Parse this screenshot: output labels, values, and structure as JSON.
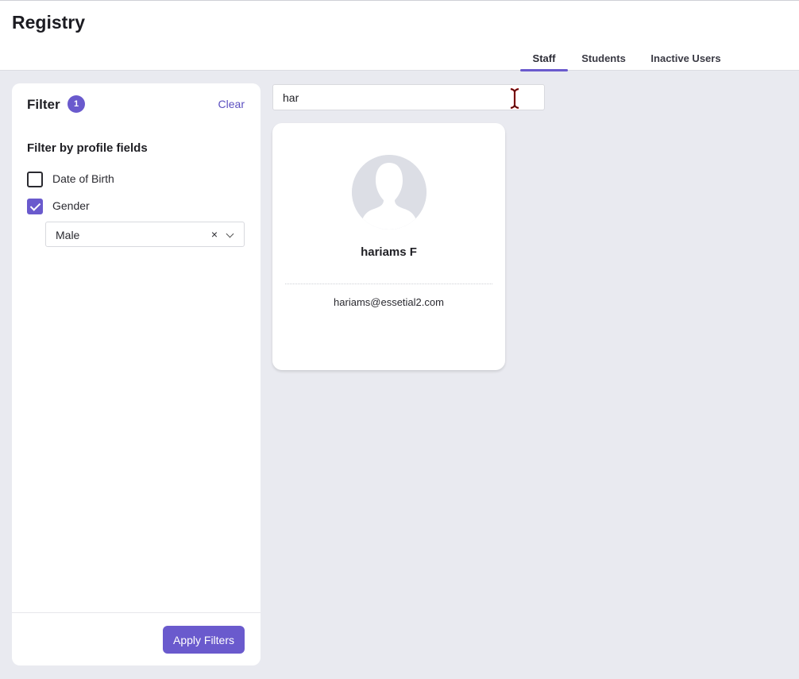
{
  "app": {
    "title": "Registry"
  },
  "tabs": [
    {
      "label": "Staff",
      "active": true
    },
    {
      "label": "Students",
      "active": false
    },
    {
      "label": "Inactive Users",
      "active": false
    }
  ],
  "filter": {
    "title": "Filter",
    "badge_count": "1",
    "clear_label": "Clear",
    "section_title": "Filter by profile fields",
    "fields": [
      {
        "label": "Date of Birth",
        "checked": false
      },
      {
        "label": "Gender",
        "checked": true
      }
    ],
    "gender_select": {
      "value": "Male",
      "clear_glyph": "×"
    },
    "apply_label": "Apply Filters"
  },
  "search": {
    "value": "har"
  },
  "results": [
    {
      "name": "hariams F",
      "email": "hariams@essetial2.com",
      "avatar_icon": "default-user-silhouette-icon"
    }
  ],
  "colors": {
    "accent": "#6a5acd",
    "background": "#e9eaf0",
    "panel": "#ffffff",
    "avatar_bg": "#dcdee5"
  }
}
